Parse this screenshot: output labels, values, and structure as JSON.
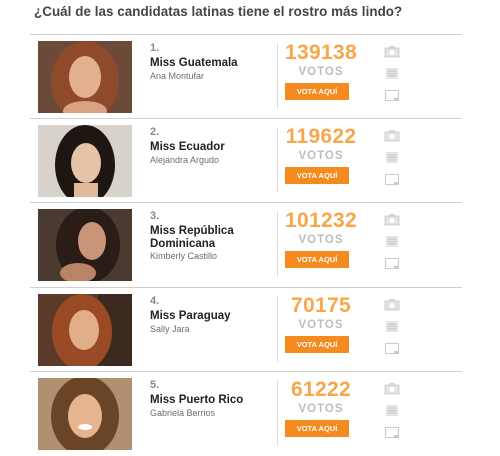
{
  "page": {
    "title": "¿Cuál de las candidatas latinas tiene el rostro más lindo?"
  },
  "candidates": [
    {
      "rank": "1.",
      "name": "Miss Guatemala",
      "subname": "Ana Montufar",
      "votes": "139138",
      "votes_label": "VOTOS",
      "button_label": "VOTA AQUÍ"
    },
    {
      "rank": "2.",
      "name": "Miss Ecuador",
      "subname": "Alejandra Argudo",
      "votes": "119622",
      "votes_label": "VOTOS",
      "button_label": "VOTA AQUÍ"
    },
    {
      "rank": "3.",
      "name": "Miss República Dominicana",
      "subname": "Kimberly Castillo",
      "votes": "101232",
      "votes_label": "VOTOS",
      "button_label": "VOTA AQUÍ"
    },
    {
      "rank": "4.",
      "name": "Miss Paraguay",
      "subname": "Sally Jara",
      "votes": "70175",
      "votes_label": "VOTOS",
      "button_label": "VOTA AQUÍ"
    },
    {
      "rank": "5.",
      "name": "Miss Puerto Rico",
      "subname": "Gabriela Berrios",
      "votes": "61222",
      "votes_label": "VOTOS",
      "button_label": "VOTA AQUÍ"
    }
  ],
  "icons": [
    "camera-icon",
    "list-icon",
    "video-icon"
  ],
  "colors": {
    "votes_number": "#f7a64a",
    "vote_button": "#f58a1f",
    "votes_label": "#bdbdbd",
    "divider": "#cfcfcf"
  }
}
